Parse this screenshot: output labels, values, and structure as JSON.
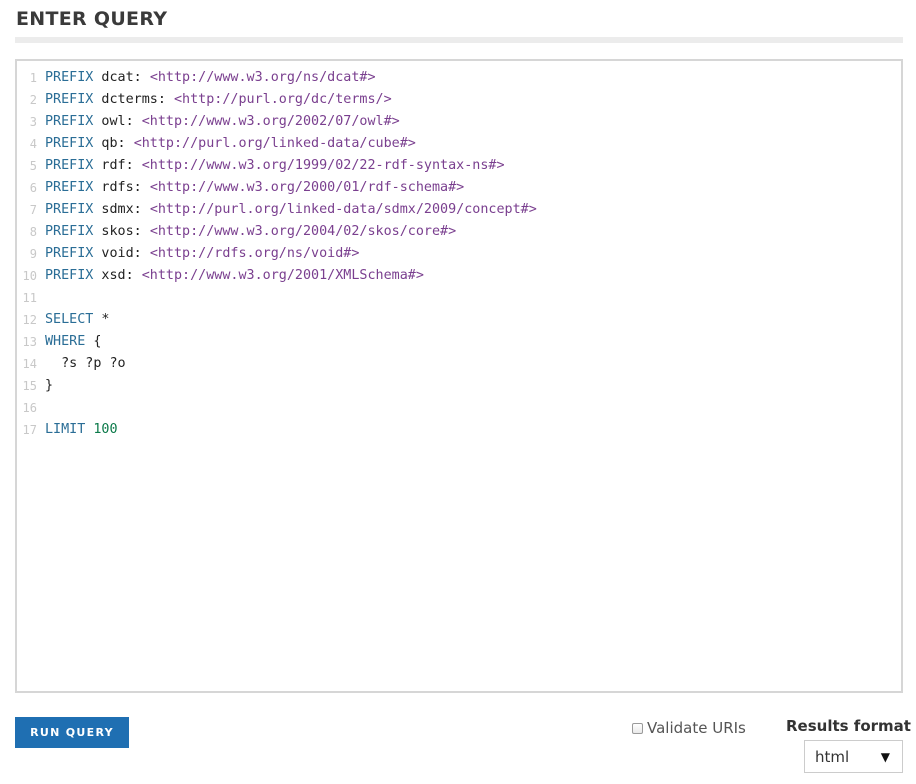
{
  "header": {
    "title": "ENTER QUERY"
  },
  "editor": {
    "lines": [
      {
        "n": "1",
        "tokens": [
          {
            "t": "PREFIX",
            "c": "kw"
          },
          {
            "t": " dcat: ",
            "c": "pn"
          },
          {
            "t": "<http://www.w3.org/ns/dcat#>",
            "c": "uri"
          }
        ]
      },
      {
        "n": "2",
        "tokens": [
          {
            "t": "PREFIX",
            "c": "kw"
          },
          {
            "t": " dcterms: ",
            "c": "pn"
          },
          {
            "t": "<http://purl.org/dc/terms/>",
            "c": "uri"
          }
        ]
      },
      {
        "n": "3",
        "tokens": [
          {
            "t": "PREFIX",
            "c": "kw"
          },
          {
            "t": " owl: ",
            "c": "pn"
          },
          {
            "t": "<http://www.w3.org/2002/07/owl#>",
            "c": "uri"
          }
        ]
      },
      {
        "n": "4",
        "tokens": [
          {
            "t": "PREFIX",
            "c": "kw"
          },
          {
            "t": " qb: ",
            "c": "pn"
          },
          {
            "t": "<http://purl.org/linked-data/cube#>",
            "c": "uri"
          }
        ]
      },
      {
        "n": "5",
        "tokens": [
          {
            "t": "PREFIX",
            "c": "kw"
          },
          {
            "t": " rdf: ",
            "c": "pn"
          },
          {
            "t": "<http://www.w3.org/1999/02/22-rdf-syntax-ns#>",
            "c": "uri"
          }
        ]
      },
      {
        "n": "6",
        "tokens": [
          {
            "t": "PREFIX",
            "c": "kw"
          },
          {
            "t": " rdfs: ",
            "c": "pn"
          },
          {
            "t": "<http://www.w3.org/2000/01/rdf-schema#>",
            "c": "uri"
          }
        ]
      },
      {
        "n": "7",
        "tokens": [
          {
            "t": "PREFIX",
            "c": "kw"
          },
          {
            "t": " sdmx: ",
            "c": "pn"
          },
          {
            "t": "<http://purl.org/linked-data/sdmx/2009/concept#>",
            "c": "uri"
          }
        ]
      },
      {
        "n": "8",
        "tokens": [
          {
            "t": "PREFIX",
            "c": "kw"
          },
          {
            "t": " skos: ",
            "c": "pn"
          },
          {
            "t": "<http://www.w3.org/2004/02/skos/core#>",
            "c": "uri"
          }
        ]
      },
      {
        "n": "9",
        "tokens": [
          {
            "t": "PREFIX",
            "c": "kw"
          },
          {
            "t": " void: ",
            "c": "pn"
          },
          {
            "t": "<http://rdfs.org/ns/void#>",
            "c": "uri"
          }
        ]
      },
      {
        "n": "10",
        "tokens": [
          {
            "t": "PREFIX",
            "c": "kw"
          },
          {
            "t": " xsd: ",
            "c": "pn"
          },
          {
            "t": "<http://www.w3.org/2001/XMLSchema#>",
            "c": "uri"
          }
        ]
      },
      {
        "n": "11",
        "tokens": []
      },
      {
        "n": "12",
        "tokens": [
          {
            "t": "SELECT",
            "c": "kw"
          },
          {
            "t": " *",
            "c": "pn"
          }
        ]
      },
      {
        "n": "13",
        "tokens": [
          {
            "t": "WHERE",
            "c": "kw"
          },
          {
            "t": " {",
            "c": "pn"
          }
        ]
      },
      {
        "n": "14",
        "tokens": [
          {
            "t": "  ?s ?p ?o",
            "c": "var"
          }
        ]
      },
      {
        "n": "15",
        "tokens": [
          {
            "t": "}",
            "c": "pn"
          }
        ]
      },
      {
        "n": "16",
        "tokens": []
      },
      {
        "n": "17",
        "tokens": [
          {
            "t": "LIMIT",
            "c": "kw"
          },
          {
            "t": " ",
            "c": "pn"
          },
          {
            "t": "100",
            "c": "num"
          }
        ]
      }
    ]
  },
  "actions": {
    "run_label": "RUN QUERY"
  },
  "options": {
    "validate_label": "Validate URIs",
    "validate_checked": false,
    "results_format_label": "Results format",
    "results_format_value": "html",
    "dropdown_icon": "triangle-down-icon"
  },
  "colors": {
    "keyword": "#2a6d96",
    "uri": "#7a3f8f",
    "number": "#0c7a4a",
    "button_bg": "#1f6fb2"
  }
}
